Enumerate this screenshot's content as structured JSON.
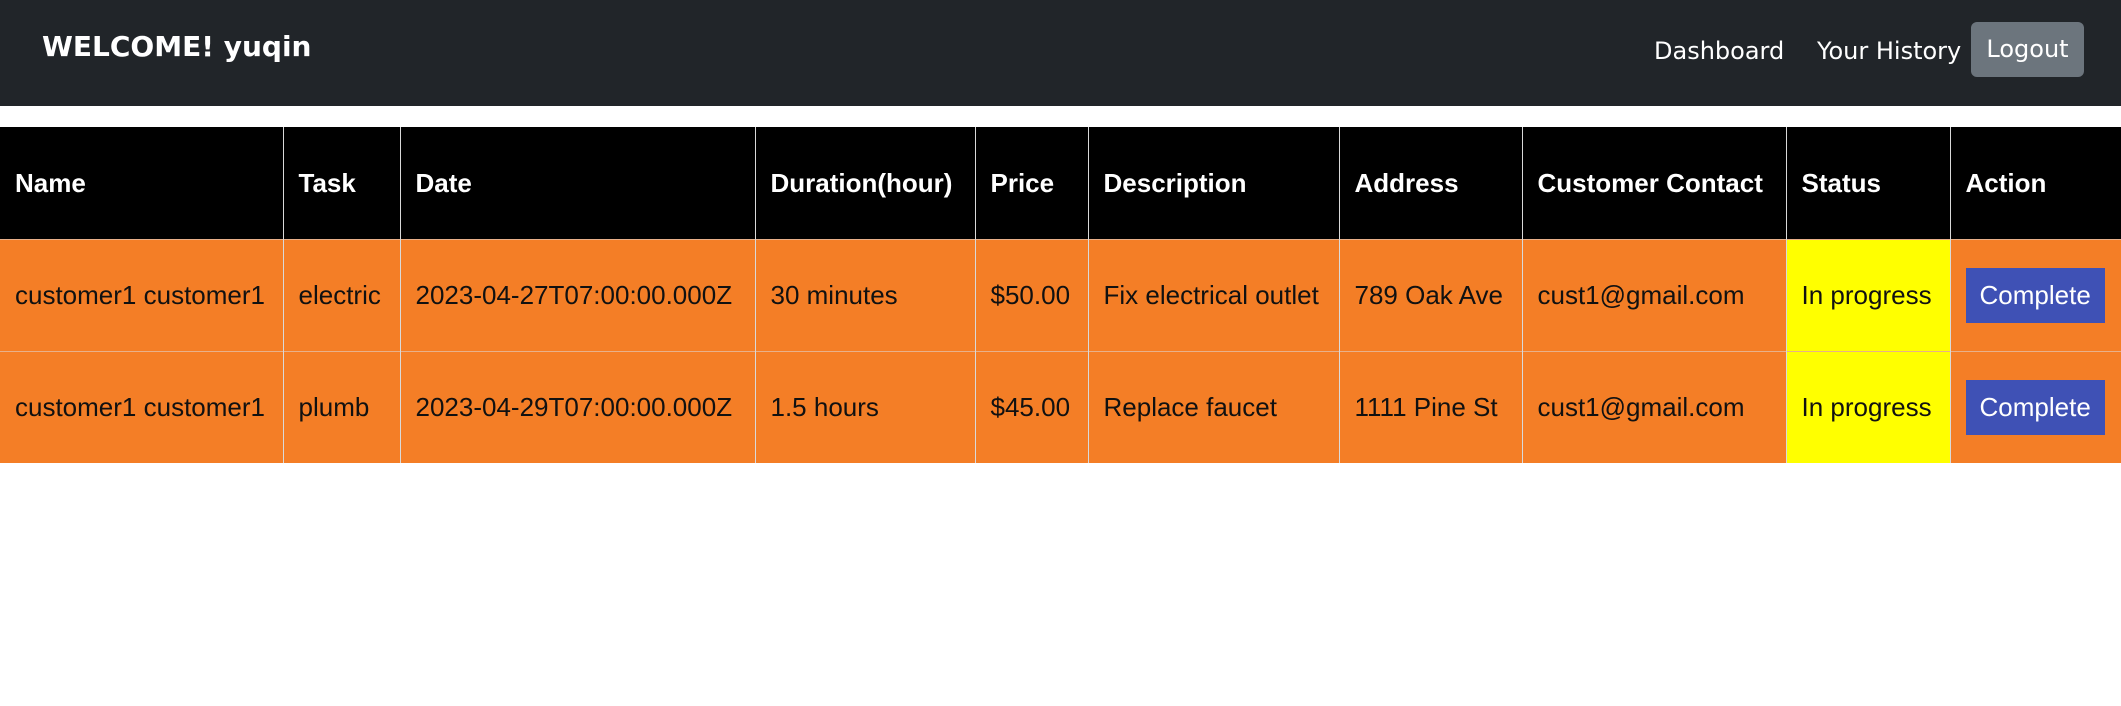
{
  "navbar": {
    "brand": "WELCOME! yuqin",
    "links": [
      {
        "label": "Dashboard"
      },
      {
        "label": "Your History"
      }
    ],
    "logout_label": "Logout"
  },
  "table": {
    "headers": {
      "name": "Name",
      "task": "Task",
      "date": "Date",
      "duration": "Duration(hour)",
      "price": "Price",
      "description": "Description",
      "address": "Address",
      "contact": "Customer Contact",
      "status": "Status",
      "action": "Action"
    },
    "rows": [
      {
        "name": "customer1 customer1",
        "task": "electric",
        "date": "2023-04-27T07:00:00.000Z",
        "duration": "30 minutes",
        "price": "$50.00",
        "description": "Fix electrical outlet",
        "address": "789 Oak Ave",
        "contact": "cust1@gmail.com",
        "status": "In progress",
        "action_label": "Complete"
      },
      {
        "name": "customer1 customer1",
        "task": "plumb",
        "date": "2023-04-29T07:00:00.000Z",
        "duration": "1.5 hours",
        "price": "$45.00",
        "description": "Replace faucet",
        "address": "1111 Pine St",
        "contact": "cust1@gmail.com",
        "status": "In progress",
        "action_label": "Complete"
      }
    ]
  },
  "colors": {
    "navbar_bg": "#212529",
    "header_bg": "#000000",
    "row_bg": "#f47e26",
    "status_bg": "#ffff00",
    "action_button_bg": "#3f51b5",
    "logout_bg": "#6c757d"
  }
}
